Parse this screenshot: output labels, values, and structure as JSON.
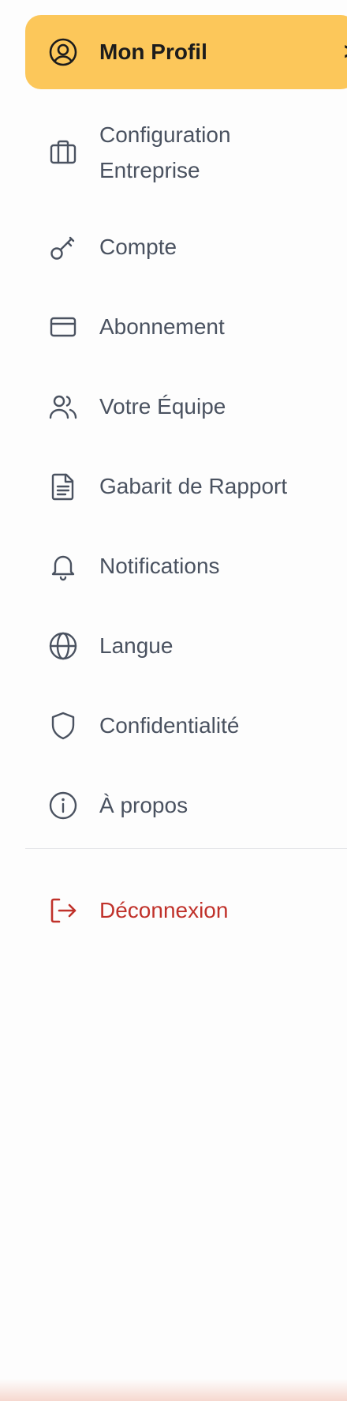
{
  "menu": {
    "items": [
      {
        "label": "Mon Profil",
        "icon": "user-circle-icon"
      },
      {
        "label": "Configuration Entreprise",
        "icon": "briefcase-icon"
      },
      {
        "label": "Compte",
        "icon": "key-icon"
      },
      {
        "label": "Abonnement",
        "icon": "credit-card-icon"
      },
      {
        "label": "Votre Équipe",
        "icon": "users-icon"
      },
      {
        "label": "Gabarit de Rapport",
        "icon": "document-icon"
      },
      {
        "label": "Notifications",
        "icon": "bell-icon"
      },
      {
        "label": "Langue",
        "icon": "globe-icon"
      },
      {
        "label": "Confidentialité",
        "icon": "shield-icon"
      },
      {
        "label": "À propos",
        "icon": "info-icon"
      }
    ],
    "active_chevron": ">",
    "logout": {
      "label": "Déconnexion",
      "icon": "logout-icon"
    }
  },
  "colors": {
    "active_bg": "#fcc75a",
    "text": "#4a5260",
    "logout": "#c0322b"
  }
}
